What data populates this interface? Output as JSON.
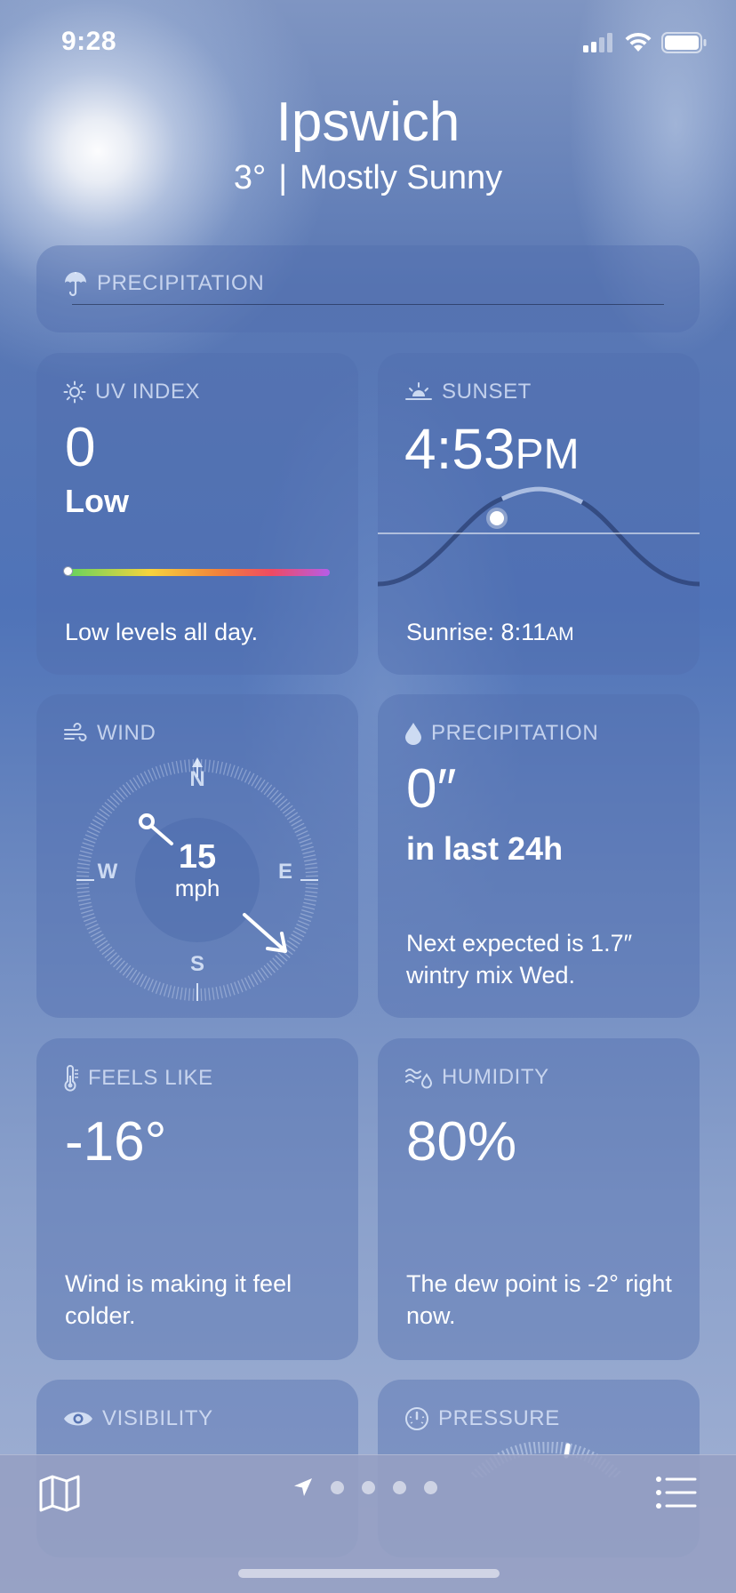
{
  "status": {
    "time": "9:28"
  },
  "header": {
    "city": "Ipswich",
    "temperature": "3°",
    "separator": "|",
    "condition": "Mostly Sunny"
  },
  "precip_bar": {
    "title": "PRECIPITATION"
  },
  "uv": {
    "title": "UV INDEX",
    "value": "0",
    "level": "Low",
    "description": "Low levels all day.",
    "indicator_fraction": 0.0
  },
  "sunset": {
    "title": "SUNSET",
    "time": "4:53",
    "ampm": "PM",
    "sunrise_label": "Sunrise: 8:11",
    "sunrise_ampm": "AM"
  },
  "wind": {
    "title": "WIND",
    "speed": "15",
    "unit": "mph",
    "north": "N",
    "south": "S",
    "east": "E",
    "west": "W"
  },
  "precipitation": {
    "title": "PRECIPITATION",
    "value": "0″",
    "period": "in last 24h",
    "description": "Next expected is 1.7″ wintry mix Wed."
  },
  "feels_like": {
    "title": "FEELS LIKE",
    "value": "-16°",
    "description": "Wind is making it feel colder."
  },
  "humidity": {
    "title": "HUMIDITY",
    "value": "80%",
    "description": "The dew point is -2° right now."
  },
  "visibility": {
    "title": "VISIBILITY"
  },
  "pressure": {
    "title": "PRESSURE"
  },
  "tabbar": {
    "page_count": 4
  },
  "colors": {
    "uv_gradient": [
      "#5fd35f",
      "#f6d33c",
      "#f2823a",
      "#ee4a63",
      "#b65de8"
    ]
  }
}
